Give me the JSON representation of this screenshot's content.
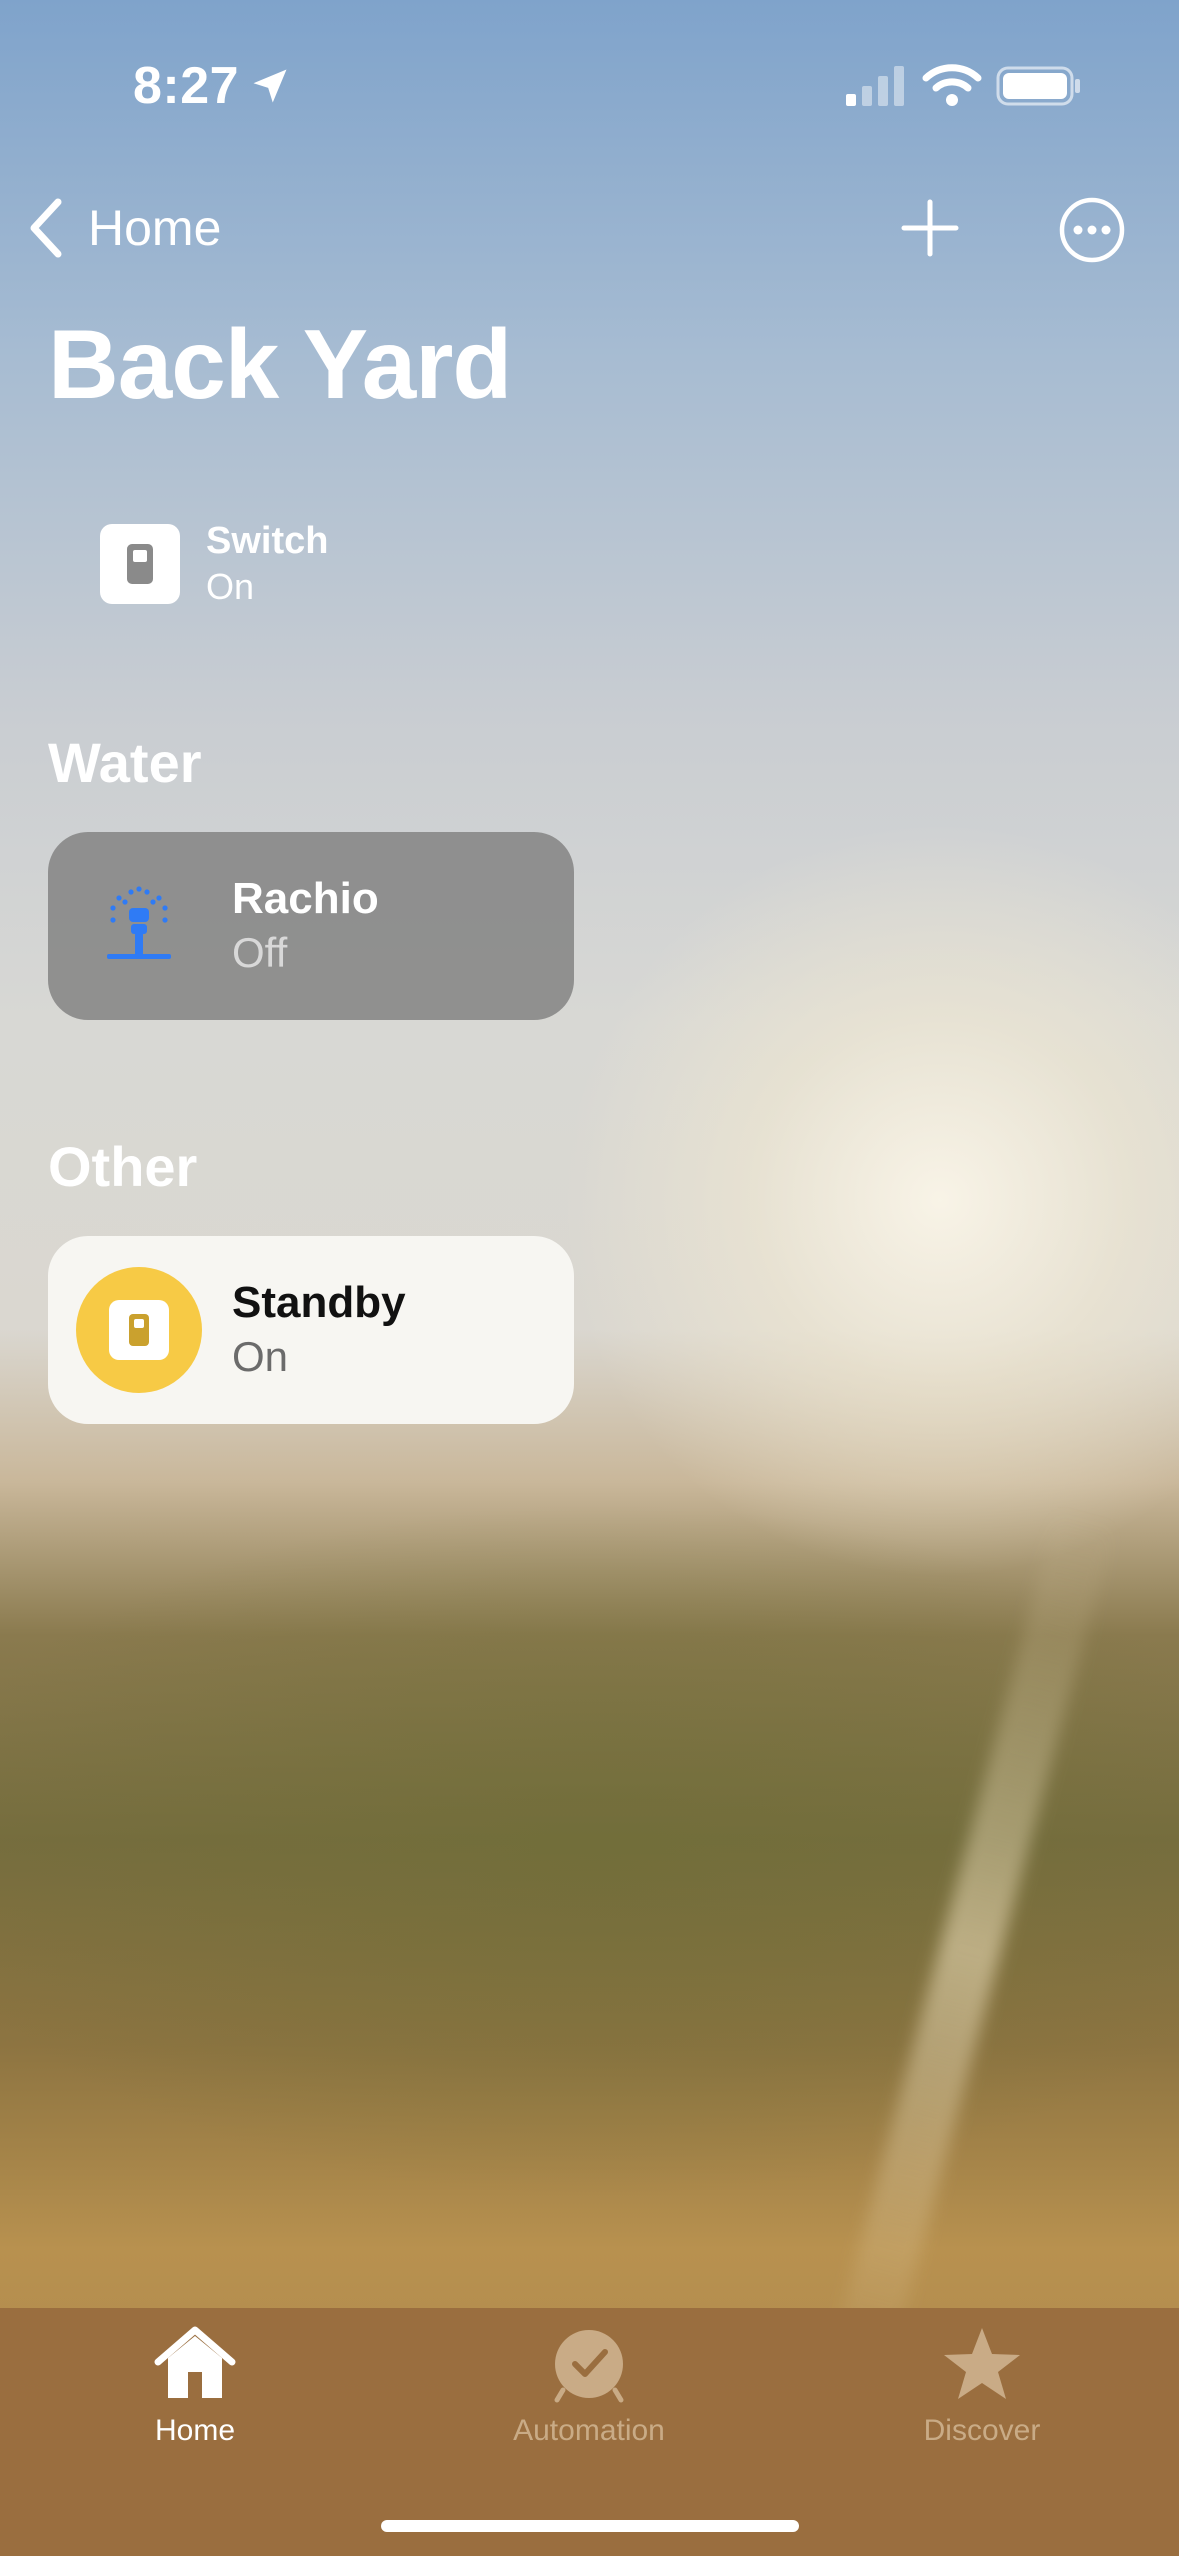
{
  "status_bar": {
    "time": "8:27"
  },
  "nav": {
    "back_label": "Home"
  },
  "page": {
    "title": "Back Yard"
  },
  "summary": {
    "name": "Switch",
    "state": "On"
  },
  "sections": [
    {
      "label": "Water",
      "tile": {
        "name": "Rachio",
        "state": "Off"
      }
    },
    {
      "label": "Other",
      "tile": {
        "name": "Standby",
        "state": "On"
      }
    }
  ],
  "tabs": [
    {
      "label": "Home",
      "selected": true
    },
    {
      "label": "Automation",
      "selected": false
    },
    {
      "label": "Discover",
      "selected": false
    }
  ],
  "colors": {
    "tile_on_icon_bg": "#f7ca45",
    "sprinkler_blue": "#2f7bf5",
    "tabbar_bg": "#9a6e3f"
  }
}
